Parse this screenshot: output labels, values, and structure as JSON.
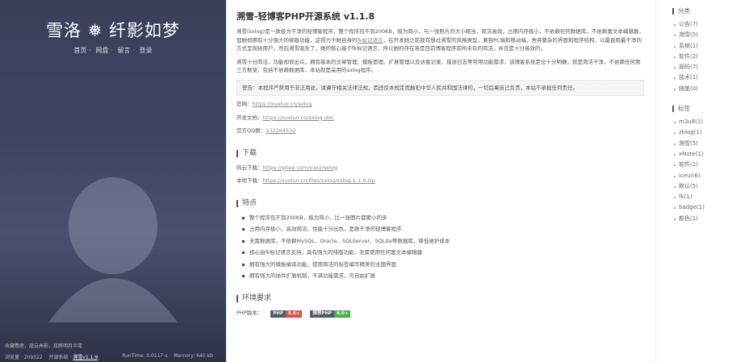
{
  "left": {
    "title": "雪洛 ❅ 纤影如梦",
    "nav": [
      "首页",
      "网盘",
      "留言",
      "登录"
    ],
    "motto": "收藏黯者，层云弄影，炫醉明月半弯",
    "visits_label": "浏览量 · 209322",
    "open_label": "开源系统 ·",
    "version_link": "溯雪v1.1.9",
    "runtime": "RunTime: 0.0117 s",
    "memory": "Memory: 640 kb"
  },
  "main": {
    "title": "溯雪-轻博客PHP开源系统 v1.1.8",
    "intro_a": "溯雪(sxlog)是一款极为干净的轻博客程序，整个程序包不到200KB，极为简小，与一张照片的大小相当，简洁高效，占用内存极小，不依赖任何数据库，不依赖富文本编辑器，但她却拥有十分强大的排版功能，这得力于她自身的",
    "intro_link": "fk标记语言",
    "intro_b": "，在开发她之前我有想过溯雪的风格类型，兼容PC端和移动端，舍弃繁杂的界面和程序结构，以最直观最干净的方式呈现给用户，然后溯雪诞生了，她的核心基于fk标记语言，所以她的存在将是目前博客程序前所未有的简洁，并且是十分高效的。",
    "para2": "溯雪十分简洁，功能却很出众，拥有基本的文章管理、模板管理、扩展管理以及访客记录、错误日志等常用功能需求，该博客系统定位十分明确，就是简洁干净，不依赖任何第三方框架，包括不依赖数据库，本站就是采用的sxlog程序。",
    "warning": "警告：本程序严禁用于非法用途，请遵守相关法律法规，因违反本规定而触犯中华人民共和国法律的，一切后果自己负责，本站不承担任何责任。",
    "links": [
      {
        "label": "官网：",
        "value": "https://xueluo.cn/sxlog"
      },
      {
        "label": "开发文档：",
        "value": "https://xueluo.cn/sxlog-doc"
      },
      {
        "label": "官方QQ群：",
        "value": "132264532"
      }
    ],
    "download_heading": "下载",
    "downloads": [
      {
        "label": "码云下载：",
        "value": "https://gitee.com/iceui/sxlog"
      },
      {
        "label": "本地下载：",
        "value": "https://xueluo.cn/files/sxlog/sxlog-1.1.9.zip"
      }
    ],
    "features_heading": "特点",
    "features": [
      "整个程序包不到200KB，极为简小，比一张图片都要小的多",
      "占用内存极小，高效简洁，性能十分出色，是款干净的轻博客程序",
      "无需数据库，不依赖MySQL、Oracle、SQLServer、SQLite等数据库，降低维护成本",
      "核心由fk标记语言支持，具有强大的排版功能，无需使用任何富文本编辑器",
      "拥有强大的模板编译功能，使用简洁的标签编写精美的主题界面",
      "拥有强大的插件扩展机制，不满功能需求，可自由扩展"
    ],
    "env_heading": "环境要求",
    "php_label": "PHP版本：",
    "badges": [
      {
        "l": "PHP",
        "r": "5.6+",
        "color": "#d9534f"
      },
      {
        "l": "推荐PHP",
        "r": "8.0+",
        "color": "#4cae4c"
      }
    ]
  },
  "side": {
    "cat_heading": "分类",
    "categories": [
      "公告(7)",
      "溯雪(5)",
      "系统(1)",
      "软件(2)",
      "源码(7)",
      "技术(1)",
      "随笔(0)"
    ],
    "tag_heading": "标签",
    "tags": [
      "m3u8(1)",
      "zblog(1)",
      "溯雪(5)",
      "xNote(1)",
      "软件(1)",
      "iceui(6)",
      "默认(5)",
      "fk(1)",
      "badge(1)",
      "颜色(1)"
    ]
  }
}
